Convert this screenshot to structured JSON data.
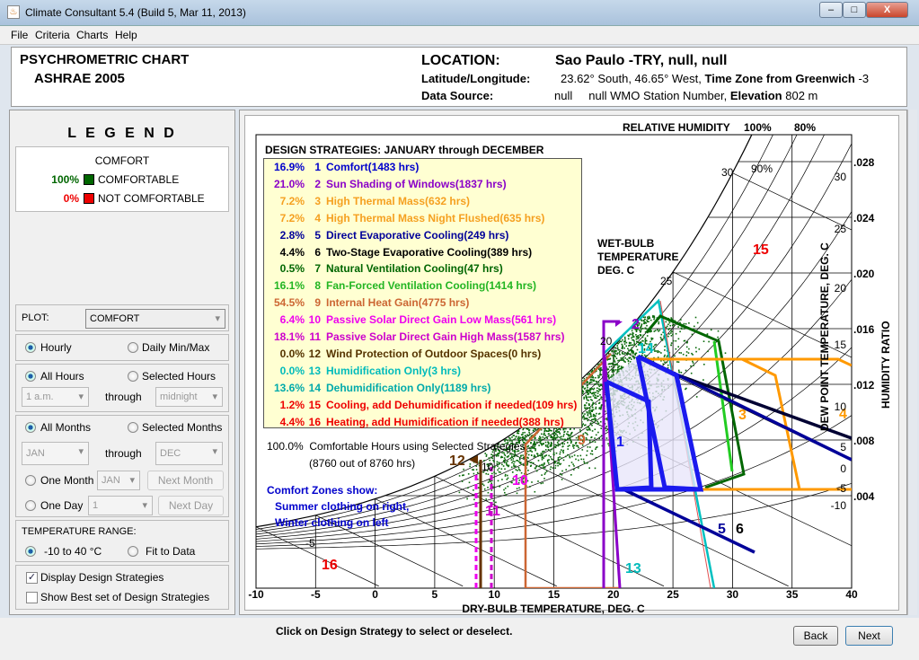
{
  "window": {
    "title": "Climate Consultant 5.4 (Build 5, Mar 11, 2013)",
    "minimize": "–",
    "maximize": "□",
    "close": "X"
  },
  "menu": [
    "File",
    "Criteria",
    "Charts",
    "Help"
  ],
  "header": {
    "chart_title": "PSYCHROMETRIC CHART",
    "chart_subtitle": "ASHRAE 2005",
    "location_label": "LOCATION:",
    "location_value": "Sao Paulo -TRY, null, null",
    "latlon_label": "Latitude/Longitude:",
    "latlon_value": "23.62° South, 46.65° West,",
    "tz_label": "Time Zone from Greenwich",
    "tz_value": "-3",
    "source_label": "Data Source:",
    "source_value": "null     null WMO Station Number,",
    "elev_label": "Elevation",
    "elev_value": "802 m"
  },
  "legend": {
    "title": "L E G E N D",
    "section": "COMFORT",
    "items": [
      {
        "pct": "100%",
        "label": "COMFORTABLE",
        "color": "#006600",
        "pct_color": "#006600"
      },
      {
        "pct": "0%",
        "label": "NOT COMFORTABLE",
        "color": "#ee0000",
        "pct_color": "#ee0000"
      }
    ]
  },
  "controls": {
    "plot_label": "PLOT:",
    "plot_value": "COMFORT",
    "hourly": "Hourly",
    "daily": "Daily Min/Max",
    "all_hours": "All Hours",
    "selected_hours": "Selected Hours",
    "hour_from": "1 a.m.",
    "through": "through",
    "hour_to": "midnight",
    "all_months": "All Months",
    "selected_months": "Selected Months",
    "month_from": "JAN",
    "month_to": "DEC",
    "one_month": "One Month",
    "one_month_value": "JAN",
    "next_month": "Next Month",
    "one_day": "One Day",
    "one_day_value": "1",
    "next_day": "Next Day",
    "temp_range_label": "TEMPERATURE RANGE:",
    "range_fixed": "-10 to 40 °C",
    "range_fit": "Fit to Data",
    "display_strategies": "Display Design Strategies",
    "display_strategies_checked": true,
    "best_set": "Show Best set of Design Strategies",
    "best_set_checked": false
  },
  "strategies": {
    "heading": "DESIGN STRATEGIES:  JANUARY through DECEMBER",
    "items": [
      {
        "pct": "16.9%",
        "num": "1",
        "name": "Comfort(1483 hrs)",
        "color": "#0000cc"
      },
      {
        "pct": "21.0%",
        "num": "2",
        "name": "Sun Shading of Windows(1837 hrs)",
        "color": "#8a00c8"
      },
      {
        "pct": "7.2%",
        "num": "3",
        "name": "High Thermal Mass(632 hrs)",
        "color": "#f5a020"
      },
      {
        "pct": "7.2%",
        "num": "4",
        "name": "High Thermal Mass Night Flushed(635 hrs)",
        "color": "#f5a020"
      },
      {
        "pct": "2.8%",
        "num": "5",
        "name": "Direct Evaporative Cooling(249 hrs)",
        "color": "#000099"
      },
      {
        "pct": "4.4%",
        "num": "6",
        "name": "Two-Stage Evaporative Cooling(389 hrs)",
        "color": "#000000"
      },
      {
        "pct": "0.5%",
        "num": "7",
        "name": "Natural Ventilation Cooling(47 hrs)",
        "color": "#006600"
      },
      {
        "pct": "16.1%",
        "num": "8",
        "name": "Fan-Forced Ventilation Cooling(1414 hrs)",
        "color": "#22b522"
      },
      {
        "pct": "54.5%",
        "num": "9",
        "name": "Internal Heat Gain(4775 hrs)",
        "color": "#cc6633"
      },
      {
        "pct": "6.4%",
        "num": "10",
        "name": "Passive Solar Direct Gain Low Mass(561 hrs)",
        "color": "#ee00ee"
      },
      {
        "pct": "18.1%",
        "num": "11",
        "name": "Passive Solar Direct Gain High Mass(1587 hrs)",
        "color": "#cc00cc"
      },
      {
        "pct": "0.0%",
        "num": "12",
        "name": "Wind Protection of Outdoor Spaces(0 hrs)",
        "color": "#553300"
      },
      {
        "pct": "0.0%",
        "num": "13",
        "name": "Humidification Only(3 hrs)",
        "color": "#00bbbb"
      },
      {
        "pct": "13.6%",
        "num": "14",
        "name": "Dehumidification Only(1189 hrs)",
        "color": "#00aaaa"
      },
      {
        "pct": "1.2%",
        "num": "15",
        "name": "Cooling, add Dehumidification if needed(109 hrs)",
        "color": "#ee0000"
      },
      {
        "pct": "4.4%",
        "num": "16",
        "name": "Heating, add Humidification if needed(388 hrs)",
        "color": "#ee0000"
      }
    ],
    "total_pct": "100.0%",
    "total_label": "Comfortable Hours using Selected Strategies",
    "total_hours": "(8760 out of 8760 hrs)"
  },
  "chart": {
    "rh_label": "RELATIVE HUMIDITY",
    "rh_100": "100%",
    "rh_80": "80%",
    "rh_90": "90%",
    "wb_label": [
      "WET-BULB",
      "TEMPERATURE",
      "DEG. C"
    ],
    "x_label": "DRY-BULB TEMPERATURE, DEG. C",
    "x_ticks": [
      "-10",
      "-5",
      "0",
      "5",
      "10",
      "15",
      "20",
      "25",
      "30",
      "35",
      "40"
    ],
    "y_label": "HUMIDITY RATIO",
    "y_ticks": [
      ".028",
      ".024",
      ".020",
      ".016",
      ".012",
      ".008",
      ".004"
    ],
    "dp_label": "DEW POINT TEMPERATURE, DEG. C",
    "dp_ticks": [
      "30",
      "25",
      "20",
      "15",
      "10",
      "5",
      "0",
      "-5",
      "-10"
    ],
    "wb_ticks": [
      "30",
      "25",
      "20",
      "10",
      "-5"
    ],
    "comfort_note": [
      "Comfort Zones show:",
      "Summer clothing on right,",
      "Winter clothing on left"
    ],
    "zone_labels": [
      "1",
      "2",
      "3",
      "4",
      "5",
      "6",
      "9",
      "10",
      "11",
      "12",
      "13",
      "14",
      "15",
      "16"
    ]
  },
  "footer": {
    "hint": "Click on Design Strategy to select or deselect.",
    "back": "Back",
    "next": "Next"
  }
}
